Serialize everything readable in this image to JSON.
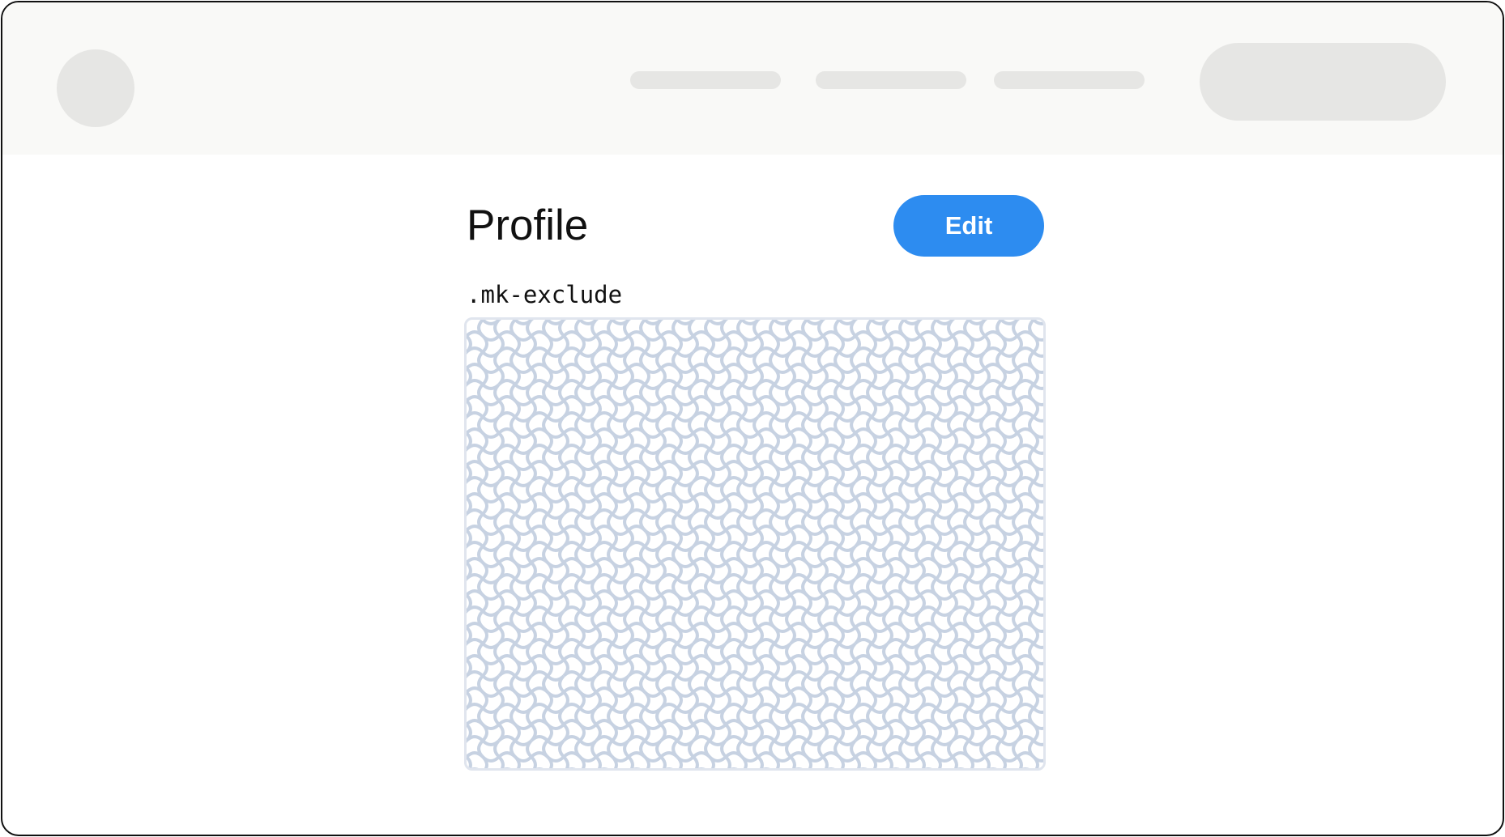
{
  "header": {
    "logo_icon": "logo-placeholder-icon",
    "nav_items": [
      "",
      "",
      ""
    ],
    "cta_label": ""
  },
  "main": {
    "title": "Profile",
    "edit_label": "Edit",
    "code_label": ".mk-exclude",
    "pattern_icon": "wave-pattern-icon"
  },
  "colors": {
    "header_bg": "#f9f9f7",
    "placeholder": "#e6e6e4",
    "accent": "#2d8cf0",
    "pattern_stroke": "#c7d2e2",
    "pattern_border": "#e0e5ee"
  }
}
